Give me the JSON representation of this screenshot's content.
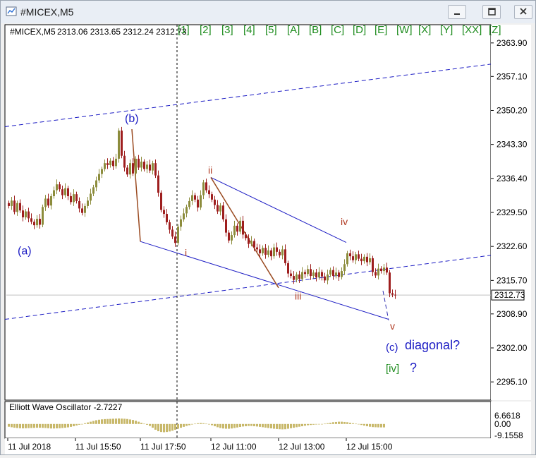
{
  "window": {
    "title": "#MICEX,M5"
  },
  "header": {
    "symbol": "#MICEX,M5",
    "ohlc": "2313.06 2313.65 2312.24 2312.73"
  },
  "wave_labels_toolbar": [
    "[1]",
    "[2]",
    "[3]",
    "[4]",
    "[5]",
    "[A]",
    "[B]",
    "[C]",
    "[D]",
    "[E]",
    "[W]",
    "[X]",
    "[Y]",
    "[XX]",
    "[Z]"
  ],
  "annotations": [
    {
      "text": "(b)",
      "color": "#1c1cc4",
      "size": 16,
      "x": "11 Jul 16:40",
      "y": 2347.8
    },
    {
      "text": "(a)",
      "color": "#1c1cc4",
      "size": 16,
      "x": "11 Jul 2018",
      "y": 2321.0
    },
    {
      "text": "i",
      "color": "#b03a22",
      "size": 14,
      "x": "11 Jul 17:50",
      "y": 2320.6
    },
    {
      "text": "ii",
      "color": "#b03a22",
      "size": 14,
      "x": "12 Jul 11:00",
      "y": 2337.4
    },
    {
      "text": "iii",
      "color": "#b03a22",
      "size": 14,
      "x": "12 Jul 13:00",
      "y": 2311.8
    },
    {
      "text": "iv",
      "color": "#b03a22",
      "size": 14,
      "x": "12 Jul 15:00",
      "y": 2326.9
    },
    {
      "text": "v",
      "color": "#b03a22",
      "size": 14,
      "x": "12 Jul 15:50",
      "y": 2305.7
    },
    {
      "text": "(c)",
      "color": "#1c1cc4",
      "size": 15,
      "x": "12 Jul 15:50",
      "y": 2301.4
    },
    {
      "text": "diagonal?",
      "color": "#1c1cc4",
      "size": 18,
      "x": "12 Jul 16:10",
      "y": 2301.7
    },
    {
      "text": "[iv]",
      "color": "#1e8c1e",
      "size": 15,
      "x": "12 Jul 15:50",
      "y": 2297.1
    },
    {
      "text": "?",
      "color": "#1c1cc4",
      "size": 18,
      "x": "12 Jul 16:10",
      "y": 2297.1
    }
  ],
  "chart_data": {
    "type": "candlestick",
    "x_labels": [
      "11 Jul 2018",
      "11 Jul 15:50",
      "11 Jul 17:50",
      "12 Jul 11:00",
      "12 Jul 13:00",
      "12 Jul 15:00"
    ],
    "y_ticks": [
      "2363.90",
      "2357.10",
      "2350.20",
      "2343.30",
      "2336.40",
      "2329.50",
      "2322.60",
      "2315.70",
      "2308.90",
      "2302.00",
      "2295.10"
    ],
    "ylim": [
      2291.4,
      2367.6
    ],
    "current_price": "2312.73",
    "series_close": [
      2330.8,
      2331.9,
      2329.6,
      2331.4,
      2329.9,
      2328.5,
      2329.7,
      2328.3,
      2327.6,
      2326.9,
      2328.2,
      2327.0,
      2330.6,
      2332.3,
      2330.9,
      2332.8,
      2334.0,
      2335.2,
      2334.2,
      2333.0,
      2334.4,
      2332.8,
      2331.6,
      2333.2,
      2331.8,
      2330.3,
      2329.4,
      2330.8,
      2331.9,
      2333.3,
      2334.6,
      2336.0,
      2337.3,
      2338.3,
      2339.5,
      2339.1,
      2340.0,
      2338.9,
      2340.4,
      2346.1,
      2341.0,
      2338.6,
      2337.2,
      2339.5,
      2337.4,
      2340.4,
      2338.6,
      2339.8,
      2338.3,
      2339.2,
      2338.0,
      2339.5,
      2337.0,
      2333.5,
      2330.0,
      2329.2,
      2327.5,
      2326.0,
      2324.6,
      2323.3,
      2326.6,
      2328.1,
      2329.3,
      2330.6,
      2331.8,
      2333.0,
      2332.1,
      2330.5,
      2333.0,
      2335.6,
      2334.0,
      2333.2,
      2332.1,
      2331.0,
      2329.7,
      2330.9,
      2328.1,
      2325.4,
      2323.8,
      2324.9,
      2326.8,
      2325.6,
      2327.8,
      2325.0,
      2324.3,
      2323.1,
      2323.7,
      2322.4,
      2322.0,
      2321.2,
      2322.3,
      2320.9,
      2321.8,
      2320.6,
      2322.4,
      2321.5,
      2320.8,
      2322.0,
      2319.2,
      2317.1,
      2316.6,
      2315.8,
      2316.9,
      2316.0,
      2317.4,
      2317.0,
      2318.0,
      2316.6,
      2317.3,
      2316.3,
      2317.4,
      2316.5,
      2315.7,
      2316.9,
      2317.8,
      2316.6,
      2317.3,
      2316.4,
      2317.6,
      2319.0,
      2321.2,
      2320.6,
      2319.8,
      2321.0,
      2320.1,
      2319.6,
      2320.5,
      2319.4,
      2320.2,
      2317.4,
      2316.7,
      2318.1,
      2317.6,
      2318.3,
      2317.3,
      2313.1,
      2312.8,
      2312.73
    ],
    "time_range": [
      "11 Jul 2018",
      "12 Jul 15:55"
    ],
    "trendlines": [
      {
        "name": "upper-channel",
        "color": "#1c1cc4",
        "dash": true,
        "from": [
          "11 Jul 2018",
          2346.9
        ],
        "to": [
          "12 Jul 15:55",
          2359.6
        ]
      },
      {
        "name": "lower-channel",
        "color": "#1c1cc4",
        "dash": true,
        "from": [
          "11 Jul 2018",
          2307.8
        ],
        "to": [
          "12 Jul 15:55",
          2320.8
        ]
      },
      {
        "name": "wedge-upper",
        "color": "#1c1cc4",
        "dash": false,
        "from": [
          "12 Jul 11:00",
          2336.6
        ],
        "to": [
          "12 Jul 15:00",
          2323.4
        ]
      },
      {
        "name": "wedge-lower",
        "color": "#1c1cc4",
        "dash": false,
        "from": [
          "11 Jul 17:50",
          2323.6
        ],
        "to": [
          "12 Jul 15:50",
          2307.8
        ]
      },
      {
        "name": "wave-b-to-i",
        "color": "#9a4a20",
        "dash": false,
        "from": [
          "11 Jul 16:40",
          2346.4
        ],
        "to": [
          "11 Jul 17:50",
          2323.6
        ]
      },
      {
        "name": "wave-ii-to-iii",
        "color": "#9a4a20",
        "dash": false,
        "from": [
          "12 Jul 11:00",
          2336.6
        ],
        "to": [
          "12 Jul 13:00",
          2314.2
        ]
      },
      {
        "name": "projection",
        "color": "#3030b0",
        "dash": true,
        "from": [
          "12 Jul 15:40",
          2313.6
        ],
        "to": [
          "12 Jul 15:50",
          2307.6
        ]
      }
    ],
    "oscillator": {
      "label": "Elliott Wave Oscillator -2.7227",
      "y_ticks": [
        "6.6618",
        "0.00",
        "-9.1558"
      ],
      "ylim": [
        -9.1558,
        6.6618
      ],
      "values": [
        -2.2,
        -2.6,
        -3.0,
        -3.2,
        -3.4,
        -3.5,
        -3.4,
        -3.3,
        -3.2,
        -3.1,
        -3.0,
        -3.0,
        -3.1,
        -3.2,
        -3.4,
        -3.6,
        -3.6,
        -3.5,
        -3.4,
        -3.2,
        -3.0,
        -2.7,
        -2.3,
        -1.8,
        -1.2,
        -0.6,
        0.0,
        0.6,
        1.2,
        1.8,
        2.4,
        3.0,
        3.4,
        3.7,
        3.9,
        4.0,
        4.1,
        4.2,
        4.3,
        4.4,
        4.3,
        4.2,
        4.0,
        3.6,
        3.2,
        2.6,
        1.8,
        1.0,
        0.2,
        -0.6,
        -1.6,
        -3.0,
        -4.6,
        -5.8,
        -6.4,
        -6.6,
        -6.4,
        -6.0,
        -5.4,
        -4.6,
        -3.8,
        -3.0,
        -2.3,
        -1.6,
        -1.0,
        -0.4,
        0.2,
        0.6,
        0.8,
        0.6,
        0.2,
        -0.4,
        -1.0,
        -1.8,
        -2.6,
        -3.2,
        -3.6,
        -3.8,
        -3.8,
        -3.6,
        -3.2,
        -2.8,
        -2.4,
        -2.0,
        -1.8,
        -1.6,
        -1.6,
        -1.8,
        -2.0,
        -2.3,
        -2.6,
        -2.9,
        -3.2,
        -3.5,
        -3.8,
        -4.0,
        -4.2,
        -4.3,
        -4.2,
        -3.8,
        -3.4,
        -3.0,
        -2.6,
        -2.2,
        -1.8,
        -1.4,
        -1.0,
        -0.8,
        -0.6,
        -0.4,
        -0.2,
        0.0,
        0.2,
        0.6,
        1.0,
        1.4,
        1.6,
        1.8,
        1.8,
        1.6,
        1.4,
        1.0,
        0.6,
        0.2,
        -0.3,
        -0.8,
        -1.3,
        -1.8,
        -2.2,
        -2.5,
        -2.6,
        -2.7,
        -2.72,
        -2.7227
      ]
    }
  },
  "colors": {
    "bull": "#8c8c3c",
    "bear": "#9e1e1e",
    "osc": "#c8b86a",
    "grid": "#000000"
  }
}
